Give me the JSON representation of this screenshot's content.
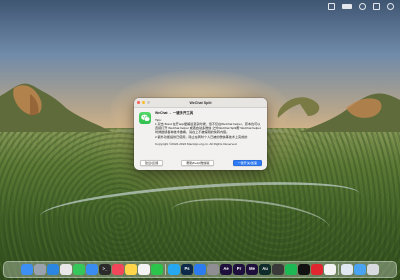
{
  "dialog": {
    "window_title": "WeChat Split",
    "headline": "WeChat → 一键多开工具",
    "tips_label": "Tips:",
    "tips_line1": "1.双击 Bond 在开app缓解最复杂时候，但不仅在WeChat helper，原本也可以直接打开 WeChat helper 或者启动多微信 之外WeChat Split帮 WeChat helper 时候继续各种技术做看，请在上不被编辑的快转内容。",
    "tips_line2": "2.额外功能提供已使用，除止在同时个人已被的微信等技术上完成的",
    "copyright": "Copyright ©2022-2024 MacApp.org.cn. All Rights Reserved",
    "buttons": {
      "left": "建议/反馈",
      "middle": "帮助/help/微信版",
      "right": "一键开关/加速"
    }
  },
  "dock": {
    "apps": [
      {
        "name": "Finder",
        "label": "",
        "color": "#3d8ff2"
      },
      {
        "name": "Launchpad",
        "label": "",
        "color": "#9aa3ad"
      },
      {
        "name": "Safari",
        "label": "",
        "color": "#2a86e0"
      },
      {
        "name": "Chrome",
        "label": "",
        "color": "#e8e8e8"
      },
      {
        "name": "Messages",
        "label": "",
        "color": "#35c759"
      },
      {
        "name": "Mail",
        "label": "",
        "color": "#3a8cf0"
      },
      {
        "name": "Terminal",
        "label": ">_",
        "color": "#2b2b2b"
      },
      {
        "name": "Music",
        "label": "",
        "color": "#f0475a"
      },
      {
        "name": "Notes",
        "label": "",
        "color": "#ffd54a"
      },
      {
        "name": "Photos",
        "label": "",
        "color": "#f3f3f3"
      },
      {
        "name": "WeChat",
        "label": "",
        "color": "#2cc44b"
      },
      {
        "name": "QQ",
        "label": "",
        "color": "#25a8f0"
      },
      {
        "name": "Photoshop",
        "label": "Ps",
        "color": "#0d2a4a"
      },
      {
        "name": "App Store",
        "label": "",
        "color": "#2c7cf0"
      },
      {
        "name": "Settings",
        "label": "",
        "color": "#8e8e93"
      },
      {
        "name": "After Effects",
        "label": "Ae",
        "color": "#1f0f3c"
      },
      {
        "name": "Premiere",
        "label": "Pr",
        "color": "#1f0f3c"
      },
      {
        "name": "Media Encoder",
        "label": "Me",
        "color": "#1f0f3c"
      },
      {
        "name": "Audition",
        "label": "Au",
        "color": "#0f2b2a"
      },
      {
        "name": "Calculator",
        "label": "",
        "color": "#3a3a3a"
      },
      {
        "name": "Spotify",
        "label": "",
        "color": "#1db954"
      },
      {
        "name": "TikTok",
        "label": "",
        "color": "#111111"
      },
      {
        "name": "Netease Music",
        "label": "",
        "color": "#e0262f"
      },
      {
        "name": "Weibo",
        "label": "",
        "color": "#f3f3f3"
      },
      {
        "name": "Preview",
        "label": "",
        "color": "#dfe7f0"
      },
      {
        "name": "Downloads",
        "label": "",
        "color": "#4aa3f0"
      },
      {
        "name": "Trash",
        "label": "",
        "color": "#d7dbe0"
      }
    ]
  },
  "colors": {
    "primary_button": "#2f7bf5",
    "wechat_green": "#2fbe4d"
  },
  "icons": {
    "app_icon": "wechat-bubbles-icon",
    "menubar": [
      "wifi-icon",
      "battery-icon",
      "search-icon",
      "control-center-icon",
      "notification-icon"
    ]
  }
}
